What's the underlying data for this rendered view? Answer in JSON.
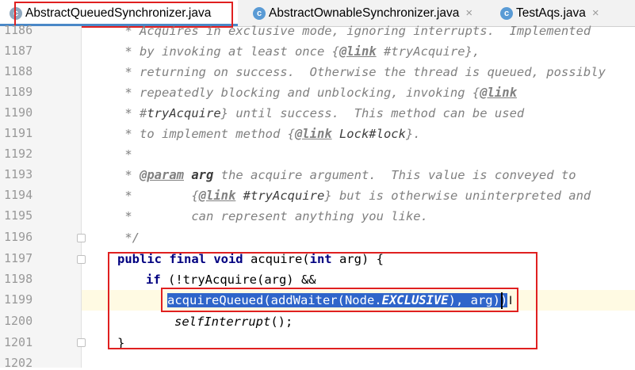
{
  "tabs": [
    {
      "label": "AbstractQueuedSynchronizer.java",
      "icon": "class-file-icon",
      "icon_glyph": "c",
      "active": true
    },
    {
      "label": "AbstractOwnableSynchronizer.java",
      "icon": "class-file-icon",
      "icon_glyph": "c",
      "active": false
    },
    {
      "label": "TestAqs.java",
      "icon": "class-file-icon",
      "icon_glyph": "c",
      "active": false
    }
  ],
  "close_glyph": "×",
  "line_numbers": [
    "1186",
    "1187",
    "1188",
    "1189",
    "1190",
    "1191",
    "1192",
    "1193",
    "1194",
    "1195",
    "1196",
    "1197",
    "1198",
    "1199",
    "1200",
    "1201",
    "1202"
  ],
  "code": {
    "l1186": " * Acquires in exclusive mode, ignoring interrupts.  Implemented",
    "l1187a": " * by invoking at least once {",
    "l1187tag": "@link",
    "l1187b": " #tryAcquire},",
    "l1188": " * returning on success.  Otherwise the thread is queued, possibly",
    "l1189a": " * repeatedly blocking and unblocking, invoking {",
    "l1189tag": "@link",
    "l1190a": " * #",
    "l1190ref": "tryAcquire",
    "l1190b": "} until success.  This method can be used",
    "l1191a": " * to implement method {",
    "l1191tag": "@link",
    "l1191ref": " Lock#lock",
    "l1191b": "}.",
    "l1192": " *",
    "l1193a": " * ",
    "l1193tag": "@param",
    "l1193arg": " arg",
    "l1193b": " the acquire argument.  This value is conveyed to",
    "l1194a": " *        {",
    "l1194tag": "@link",
    "l1194ref": " #tryAcquire",
    "l1194b": "} but is otherwise uninterpreted and",
    "l1195": " *        can represent anything you like.",
    "l1196": " */",
    "l1197kw": "public final void",
    "l1197a": " acquire(",
    "l1197kw2": "int",
    "l1197b": " arg) {",
    "l1198kw": "if",
    "l1198a": " (!tryAcquire(arg) &&",
    "l1199a": "acquireQueued(addWaiter(Node.",
    "l1199it": "EXCLUSIVE",
    "l1199b": "), arg))",
    "l1200": "selfInterrupt",
    "l1200b": "();",
    "l1201": "}"
  },
  "colors": {
    "highlight_border": "#e02020",
    "selection": "#2f65ca",
    "keyword": "#000080",
    "comment": "#808080"
  }
}
